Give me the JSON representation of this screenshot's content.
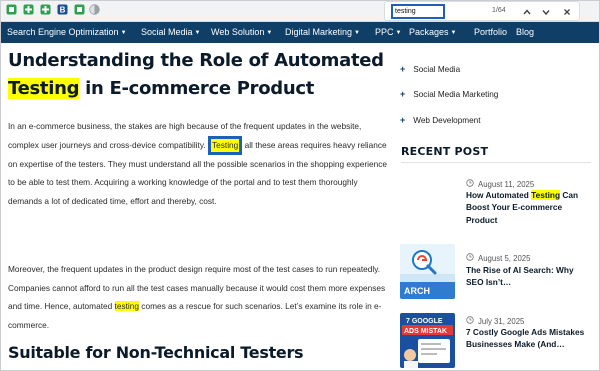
{
  "browser": {
    "bookmarks": [
      {
        "icon": "green-square-icon",
        "color": "#2e9e4f"
      },
      {
        "icon": "green-plus-icon",
        "color": "#2e9e4f"
      },
      {
        "icon": "green-plus-icon",
        "color": "#2e9e4f"
      },
      {
        "icon": "bold-b-icon",
        "color": "#1a4f8f"
      },
      {
        "icon": "green-square-icon",
        "color": "#2e9e4f"
      },
      {
        "icon": "half-circle-icon",
        "color": "#9aa0a6"
      }
    ],
    "find": {
      "query": "testing",
      "count": "1/64"
    }
  },
  "nav": {
    "items": [
      {
        "label": "Search Engine Optimization",
        "dropdown": true
      },
      {
        "label": "Social Media",
        "dropdown": true
      },
      {
        "label": "Web Solution",
        "dropdown": true
      },
      {
        "label": "Digital Marketing",
        "dropdown": true
      },
      {
        "label": "PPC",
        "dropdown": true
      },
      {
        "label": "Packages",
        "dropdown": true
      },
      {
        "label": "Portfolio",
        "dropdown": false
      },
      {
        "label": "Blog",
        "dropdown": false
      }
    ]
  },
  "article": {
    "title_line1": "Understanding the Role of Automated",
    "title_hl": "Testing",
    "title_line2_rest": " in E-commerce Product",
    "p1_before": "In an e-commerce business, the stakes are high because of the frequent updates in the website, complex user journeys and cross-device compatibility. ",
    "p1_match": "Testing",
    "p1_after": " all these areas requires heavy reliance on expertise of the testers. They must understand all the possible scenarios in the shopping experience to be able to test them. Acquiring a working knowledge of the portal and to test them thoroughly demands a lot of dedicated time, effort and thereby, cost.",
    "p2_before": "Moreover, the frequent updates in the product design require most of the test cases to run repeatedly. Companies cannot afford to run all the test cases manually because it would cost them more expenses and time. Hence, automated ",
    "p2_match": "testing",
    "p2_after": " comes as a rescue for such scenarios. Let’s examine its role in e-commerce.",
    "h2": "Suitable for Non-Technical Testers"
  },
  "sidebar": {
    "categories": [
      "Social Media",
      "Social Media Marketing",
      "Web Development"
    ],
    "recent_title": "RECENT POST",
    "posts": [
      {
        "date": "August 11, 2025",
        "title_before": "How Automated ",
        "title_hl": "Testing",
        "title_after": " Can Boost Your E-commerce Product",
        "thumb": "none"
      },
      {
        "date": "August 5, 2025",
        "title_before": "The Rise of AI Search: Why SEO Isn’t…",
        "title_hl": "",
        "title_after": "",
        "thumb": "google-search-graphic"
      },
      {
        "date": "July 31, 2025",
        "title_before": "7 Costly Google Ads Mistakes Businesses Make (And…",
        "title_hl": "",
        "title_after": "",
        "thumb": "google-ads-mistakes-graphic",
        "thumb_text": "7 GOOGLE ADS MISTAK"
      }
    ]
  },
  "colors": {
    "nav_bg": "#0f3e66",
    "highlight": "#ffff00",
    "find_box": "#1f5fb5"
  }
}
